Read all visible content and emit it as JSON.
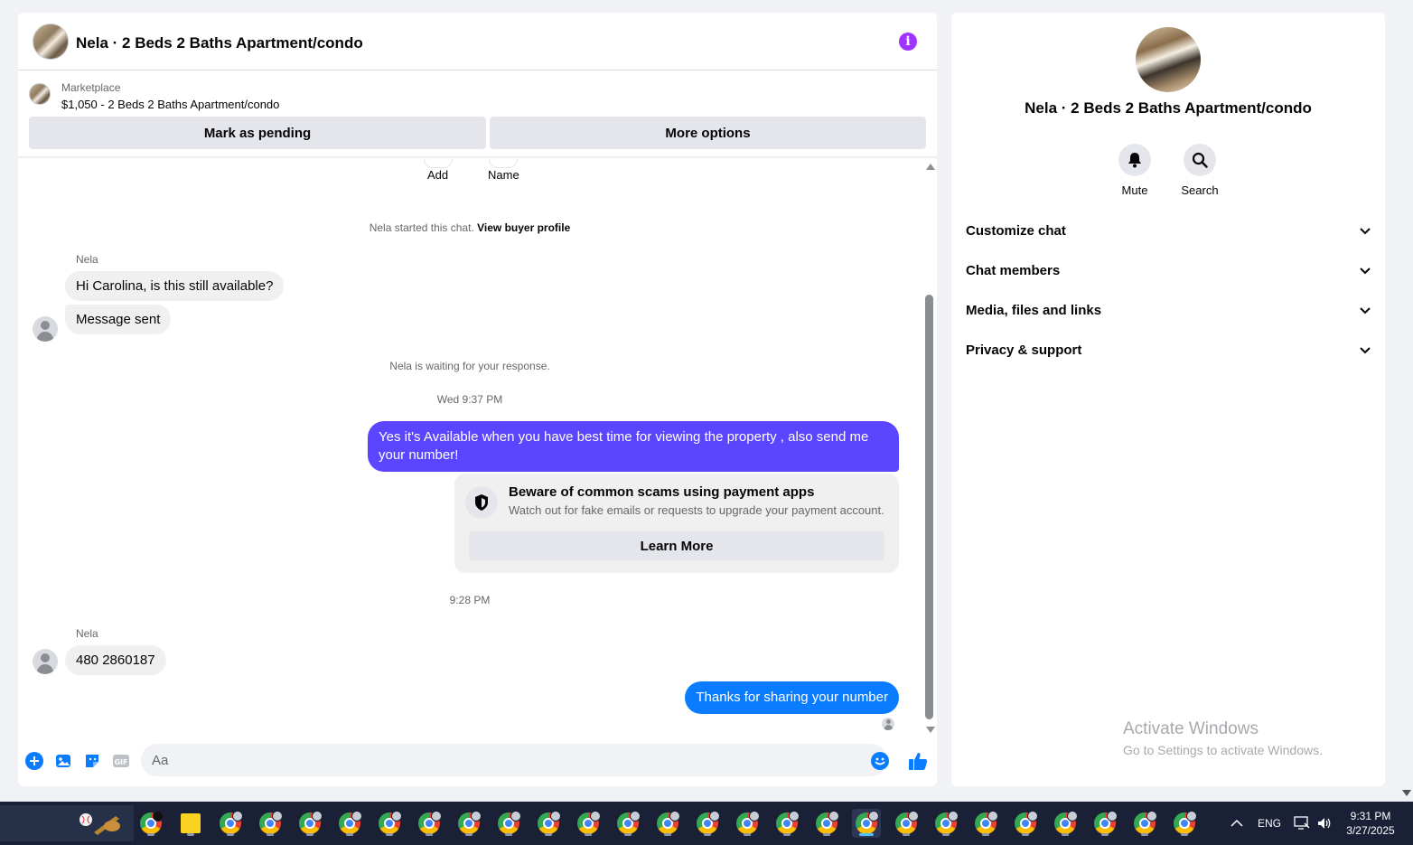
{
  "chat": {
    "title": "Nela · 2 Beds 2 Baths Apartment/condo",
    "listing": {
      "source": "Marketplace",
      "price_title": "$1,050 - 2 Beds 2 Baths Apartment/condo"
    },
    "buttons": {
      "pending": "Mark as pending",
      "more": "More options"
    },
    "top_actions": {
      "add": "Add",
      "name": "Name"
    },
    "started_prefix": "Nela started this chat.",
    "view_profile": "View buyer profile",
    "sender_name": "Nela",
    "messages_in_1": [
      "Hi Carolina, is this still available?",
      "Message sent"
    ],
    "waiting": "Nela is waiting for your response.",
    "timestamp_1": "Wed 9:37 PM",
    "outgoing_1": "Yes it's Available when you have best time for viewing the property , also send me your number!",
    "scam": {
      "title": "Beware of common scams using payment apps",
      "subtitle": "Watch out for fake emails or requests to upgrade your payment account.",
      "button": "Learn More"
    },
    "timestamp_2": "9:28 PM",
    "sender_name_2": "Nela",
    "incoming_2": "480 2860187",
    "outgoing_2": "Thanks for sharing your number",
    "composer_placeholder": "Aa",
    "gif_label": "GIF"
  },
  "info_panel": {
    "name": "Nela · 2 Beds 2 Baths Apartment/condo",
    "actions": {
      "mute": "Mute",
      "search": "Search"
    },
    "sections": [
      "Customize chat",
      "Chat members",
      "Media, files and links",
      "Privacy & support"
    ]
  },
  "watermark": {
    "title": "Activate Windows",
    "subtitle": "Go to Settings to activate Windows."
  },
  "taskbar": {
    "language": "ENG",
    "time": "9:31 PM",
    "date": "3/27/2025"
  },
  "colors": {
    "accent_purple": "#5b45ff",
    "accent_blue": "#0a7cff",
    "info_icon": "#a033ff",
    "messenger_blue": "#0a7cff"
  },
  "icons": {
    "info": "info-icon",
    "mute": "bell-icon",
    "search": "search-icon",
    "chevron": "chevron-down-icon",
    "shield": "shield-icon",
    "composer": [
      "plus-icon",
      "image-icon",
      "sticker-icon",
      "gif-icon",
      "emoji-icon",
      "like-icon"
    ]
  }
}
